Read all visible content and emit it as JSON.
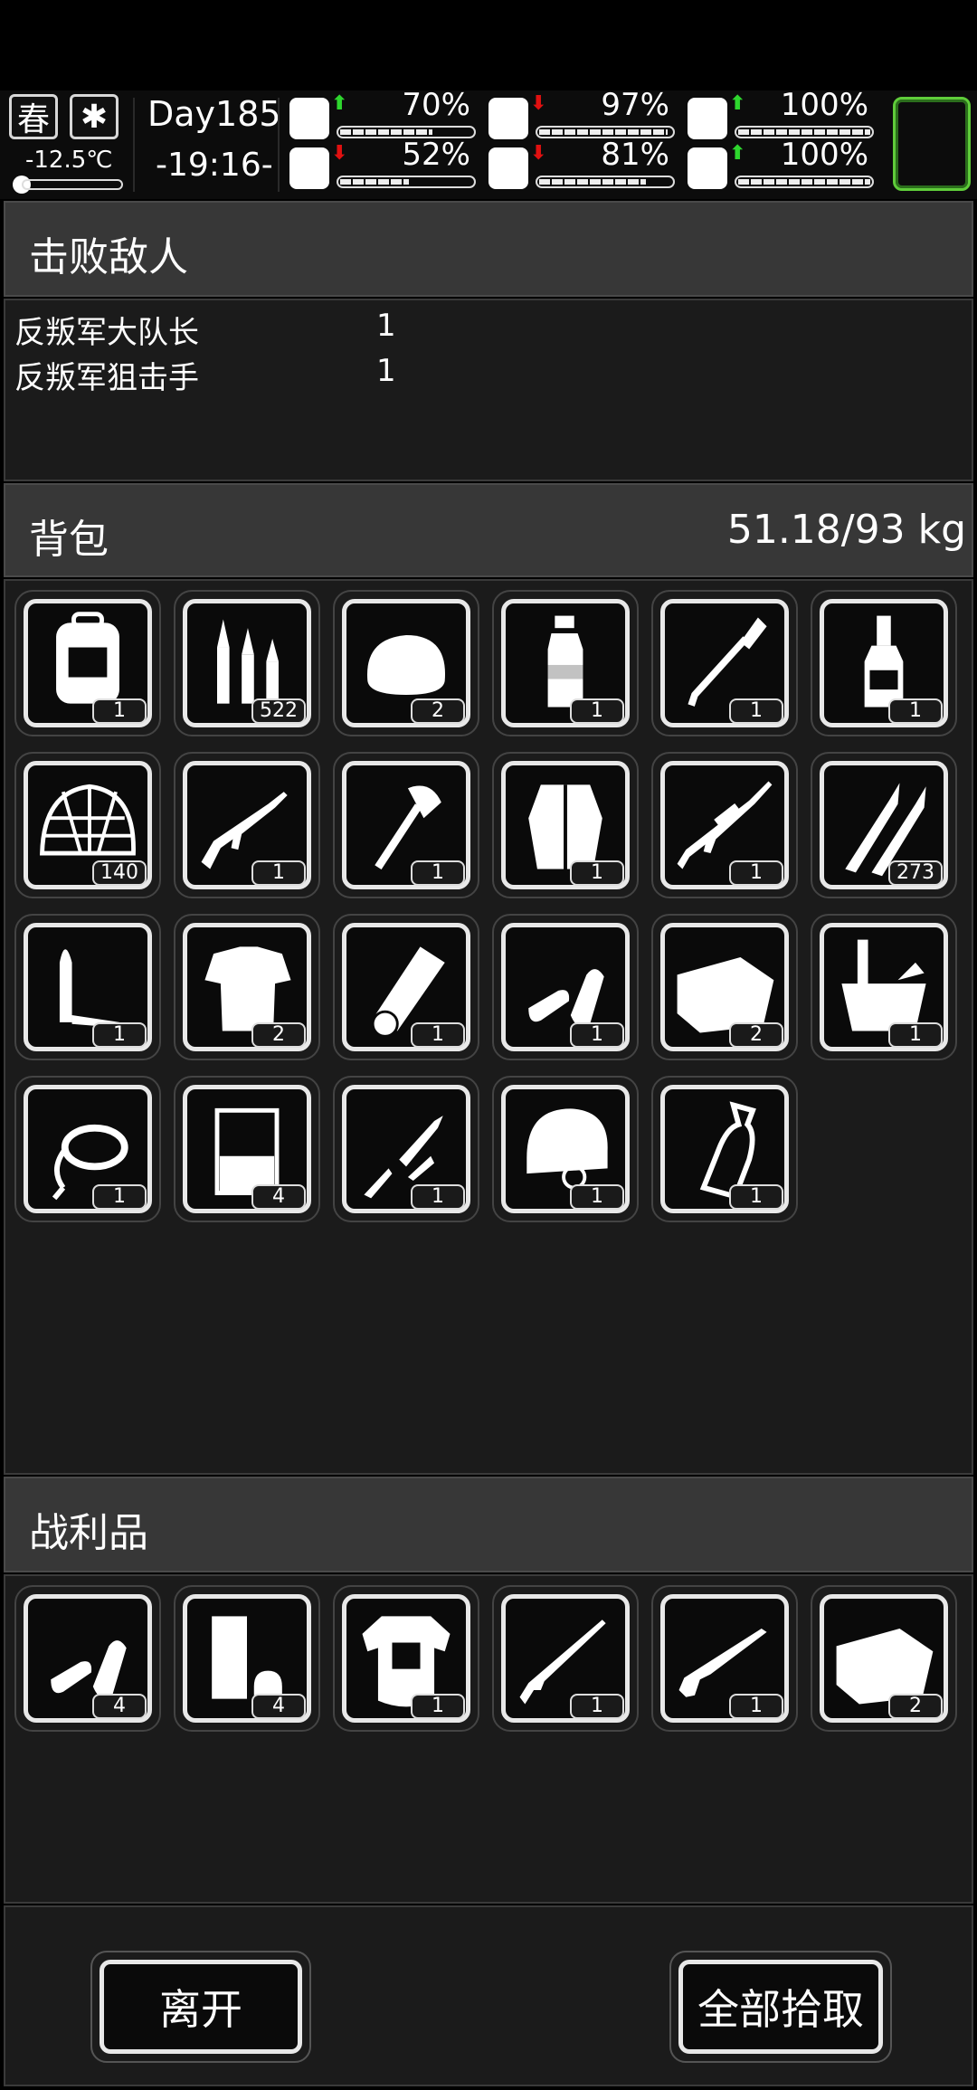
{
  "status": {
    "season": "春",
    "weather_icon": "snowflake-icon",
    "temperature": "-12.5℃",
    "day": "Day185",
    "time": "-19:16-",
    "stats": [
      {
        "name": "health",
        "icon": "medkit-icon",
        "trend": "up",
        "value_text": "70%",
        "fill": 0.7
      },
      {
        "name": "hunger",
        "icon": "stomach-icon",
        "trend": "down",
        "value_text": "97%",
        "fill": 0.97
      },
      {
        "name": "mood",
        "icon": "pill-icon",
        "trend": "up",
        "value_text": "100%",
        "fill": 1.0
      },
      {
        "name": "stamina",
        "icon": "foot-icon",
        "trend": "down",
        "value_text": "52%",
        "fill": 0.52
      },
      {
        "name": "thirst",
        "icon": "water-drop-icon",
        "trend": "down",
        "value_text": "81%",
        "fill": 0.81
      },
      {
        "name": "heart",
        "icon": "heart-icon",
        "trend": "up",
        "value_text": "100%",
        "fill": 1.0
      }
    ],
    "accent_green": "#5fcc3a",
    "up_color": "#2ed62e",
    "down_color": "#e01010"
  },
  "defeated": {
    "title": "击败敌人",
    "enemies": [
      {
        "name": "反叛军大队长",
        "count": "1"
      },
      {
        "name": "反叛军狙击手",
        "count": "1"
      }
    ]
  },
  "backpack": {
    "title": "背包",
    "weight": "51.18/93 kg",
    "items": [
      {
        "icon": "backpack-icon",
        "qty": "1"
      },
      {
        "icon": "rifle-ammo-icon",
        "qty": "522"
      },
      {
        "icon": "bread-icon",
        "qty": "2"
      },
      {
        "icon": "water-bottle-icon",
        "qty": "1"
      },
      {
        "icon": "shovel-icon",
        "qty": "1"
      },
      {
        "icon": "liquor-bottle-icon",
        "qty": "1"
      },
      {
        "icon": "camo-net-icon",
        "qty": "140"
      },
      {
        "icon": "assault-rifle-icon",
        "qty": "1"
      },
      {
        "icon": "axe-icon",
        "qty": "1"
      },
      {
        "icon": "fur-coat-icon",
        "qty": "1"
      },
      {
        "icon": "sniper-rifle-icon",
        "qty": "1"
      },
      {
        "icon": "large-bullets-icon",
        "qty": "273"
      },
      {
        "icon": "bullet-casing-icon",
        "qty": "1"
      },
      {
        "icon": "torn-shirt-icon",
        "qty": "2"
      },
      {
        "icon": "cloth-roll-icon",
        "qty": "1"
      },
      {
        "icon": "pistol-ammo-icon",
        "qty": "1"
      },
      {
        "icon": "cloth-sheet-icon",
        "qty": "2"
      },
      {
        "icon": "bucket-icon",
        "qty": "1"
      },
      {
        "icon": "rope-icon",
        "qty": "1"
      },
      {
        "icon": "beaker-icon",
        "qty": "4"
      },
      {
        "icon": "rifle-parts-icon",
        "qty": "1"
      },
      {
        "icon": "helmet-icon",
        "qty": "1"
      },
      {
        "icon": "empty-bottle-icon",
        "qty": "1"
      }
    ]
  },
  "loot": {
    "title": "战利品",
    "items": [
      {
        "icon": "pistol-ammo-icon",
        "qty": "4"
      },
      {
        "icon": "ammo-box-icon",
        "qty": "4"
      },
      {
        "icon": "body-armor-icon",
        "qty": "1"
      },
      {
        "icon": "bolt-rifle-icon",
        "qty": "1"
      },
      {
        "icon": "shotgun-icon",
        "qty": "1"
      },
      {
        "icon": "cloth-sheet-icon",
        "qty": "2"
      }
    ]
  },
  "actions": {
    "leave": "离开",
    "take_all": "全部拾取"
  }
}
